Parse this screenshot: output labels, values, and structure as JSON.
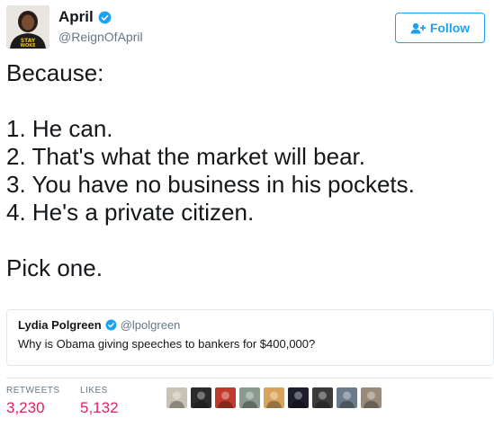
{
  "author": {
    "name": "April",
    "handle": "@ReignOfApril",
    "avatar_shirt_text": "STAY WOKE"
  },
  "follow_button": {
    "label": "Follow"
  },
  "tweet": {
    "text": "Because:\n\n1. He can.\n2. That's what the market will bear.\n3. You have no business in his pockets.\n4. He's a private citizen.\n\nPick one."
  },
  "quoted_tweet": {
    "name": "Lydia Polgreen",
    "handle": "@lpolgreen",
    "text": "Why is Obama giving speeches to bankers for $400,000?"
  },
  "stats": {
    "retweets_label": "RETWEETS",
    "retweets_value": "3,230",
    "likes_label": "LIKES",
    "likes_value": "5,132"
  },
  "liker_avatars": [
    {
      "color": "#c9c3b5"
    },
    {
      "color": "#2b2b2b"
    },
    {
      "color": "#c0392b"
    },
    {
      "color": "#8a9a8f"
    },
    {
      "color": "#d9a35b"
    },
    {
      "color": "#1d1d2b"
    },
    {
      "color": "#3b3b3b"
    },
    {
      "color": "#6b7b8c"
    },
    {
      "color": "#9a8a7a"
    }
  ],
  "colors": {
    "accent": "#1da1f2",
    "likes": "#e0245e",
    "muted": "#657786"
  }
}
